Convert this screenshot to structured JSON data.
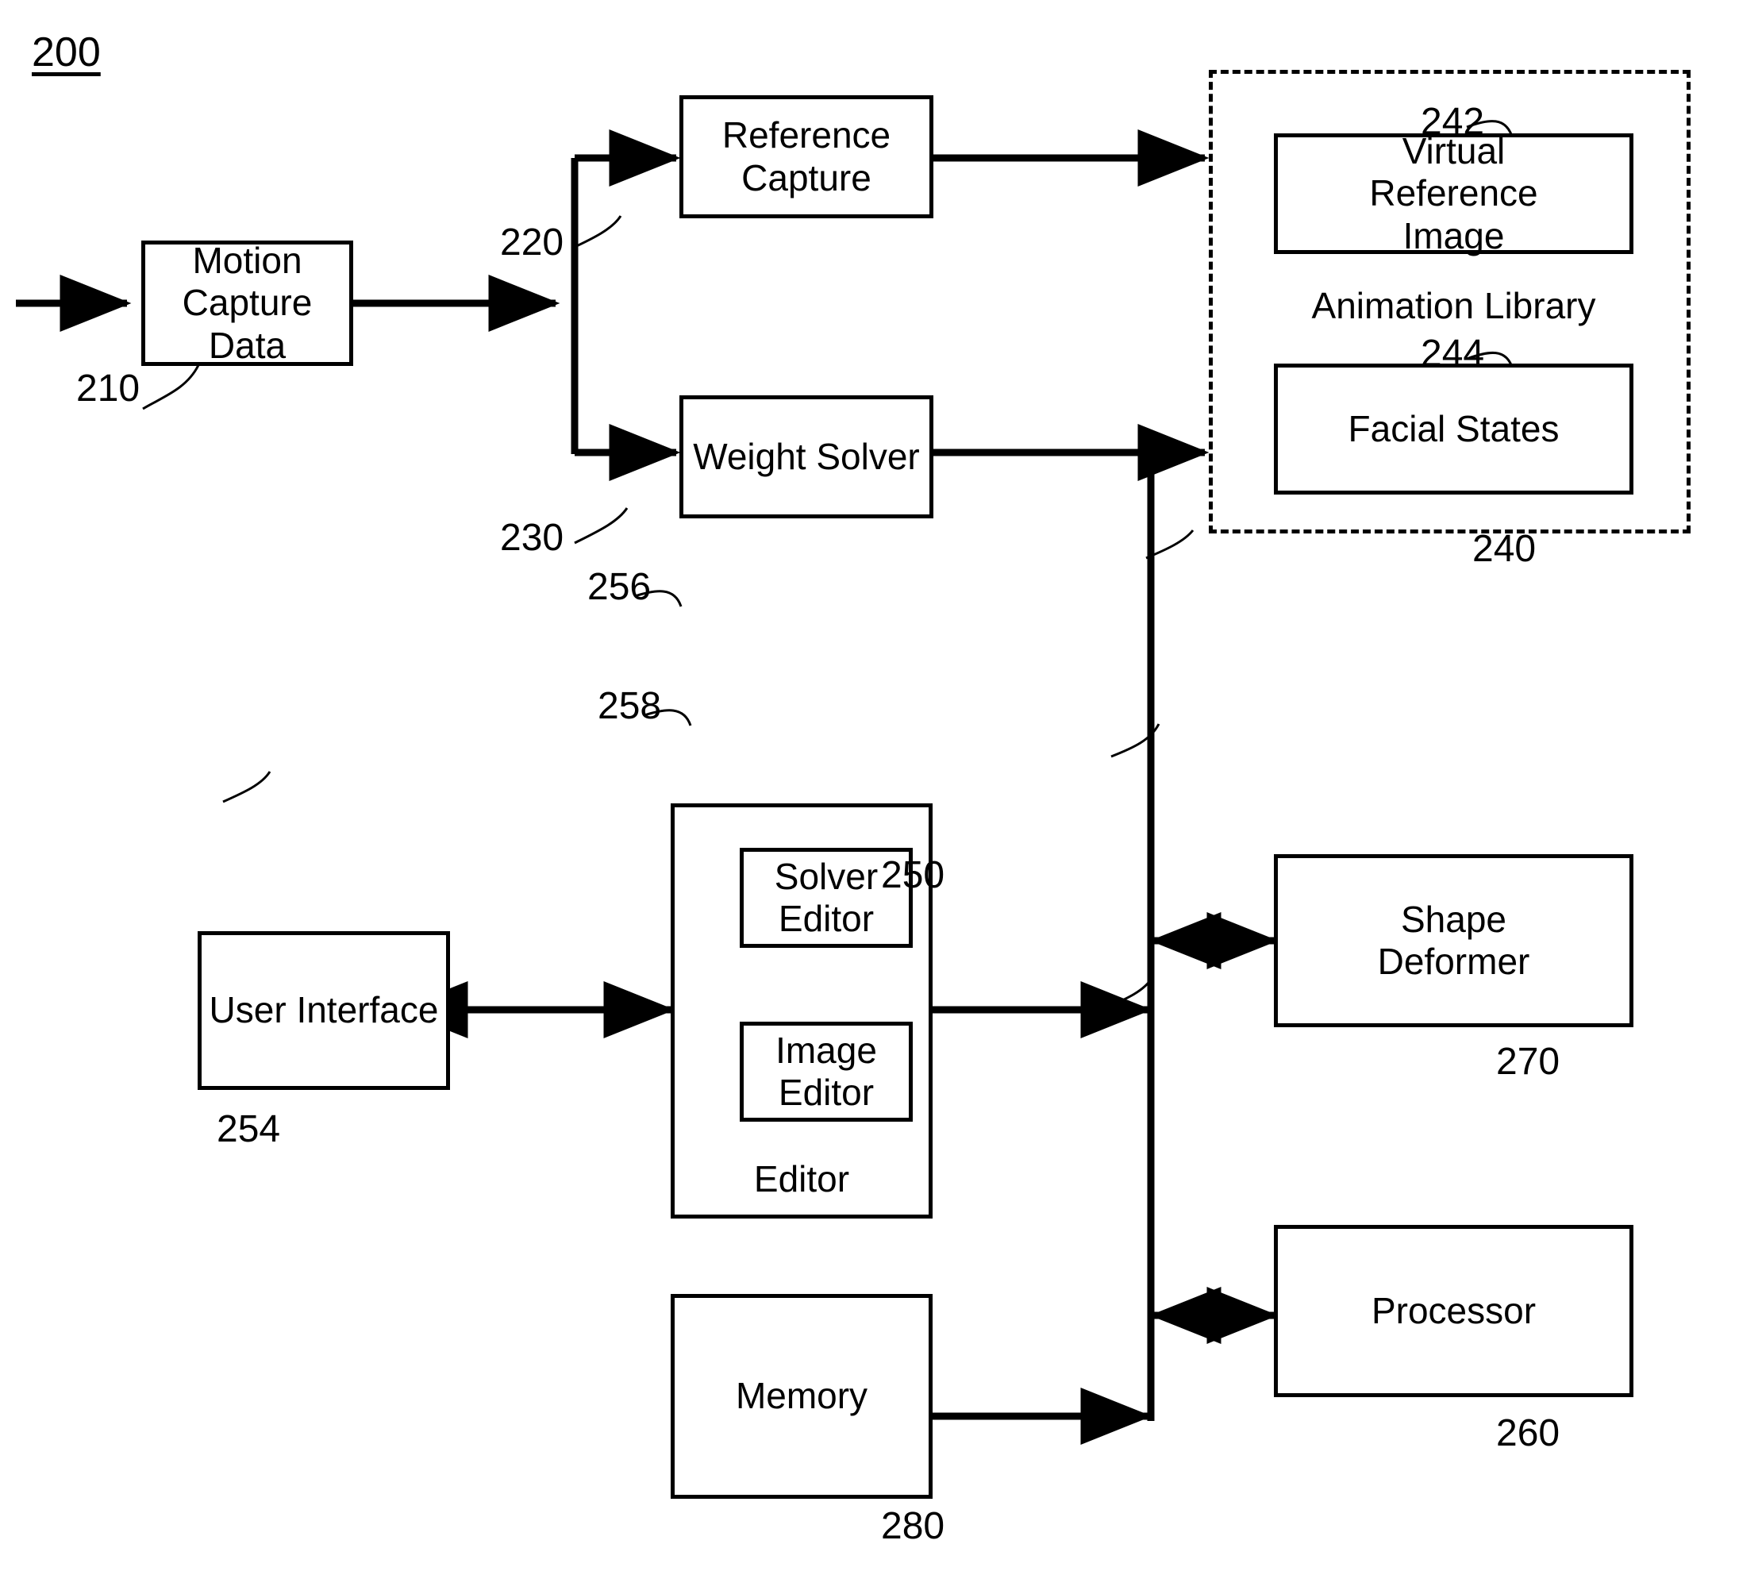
{
  "figure": {
    "number": "200",
    "type": "patent-block-diagram"
  },
  "blocks": {
    "motion_capture_data": {
      "label": "Motion Capture\nData",
      "ref": "210"
    },
    "reference_capture": {
      "label": "Reference\nCapture",
      "ref": "220"
    },
    "weight_solver": {
      "label": "Weight Solver",
      "ref": "230"
    },
    "animation_library": {
      "label": "Animation Library",
      "ref": "240"
    },
    "virtual_reference_image": {
      "label": "Virtual\nReference\nImage",
      "ref": "242"
    },
    "facial_states": {
      "label": "Facial States",
      "ref": "244"
    },
    "editor": {
      "label": "Editor",
      "ref": "250"
    },
    "user_interface": {
      "label": "User Interface",
      "ref": "254"
    },
    "solver_editor": {
      "label": "Solver\nEditor",
      "ref": "256"
    },
    "image_editor": {
      "label": "Image\nEditor",
      "ref": "258"
    },
    "processor": {
      "label": "Processor",
      "ref": "260"
    },
    "shape_deformer": {
      "label": "Shape\nDeformer",
      "ref": "270"
    },
    "memory": {
      "label": "Memory",
      "ref": "280"
    }
  },
  "labels": {
    "fig": "200",
    "r210": "210",
    "r220": "220",
    "r230": "230",
    "r240": "240",
    "r242": "242",
    "r244": "244",
    "r250": "250",
    "r254": "254",
    "r256": "256",
    "r258": "258",
    "r260": "260",
    "r270": "270",
    "r280": "280"
  },
  "text": {
    "motion_capture_data_l1": "Motion Capture",
    "motion_capture_data_l2": "Data",
    "reference_capture_l1": "Reference",
    "reference_capture_l2": "Capture",
    "weight_solver": "Weight Solver",
    "virtual_reference_image_l1": "Virtual",
    "virtual_reference_image_l2": "Reference",
    "virtual_reference_image_l3": "Image",
    "animation_library": "Animation Library",
    "facial_states": "Facial States",
    "solver_editor_l1": "Solver",
    "solver_editor_l2": "Editor",
    "image_editor_l1": "Image",
    "image_editor_l2": "Editor",
    "editor": "Editor",
    "user_interface": "User Interface",
    "shape_deformer_l1": "Shape",
    "shape_deformer_l2": "Deformer",
    "processor": "Processor",
    "memory": "Memory"
  },
  "colors": {
    "stroke": "#000000",
    "background": "#ffffff"
  }
}
